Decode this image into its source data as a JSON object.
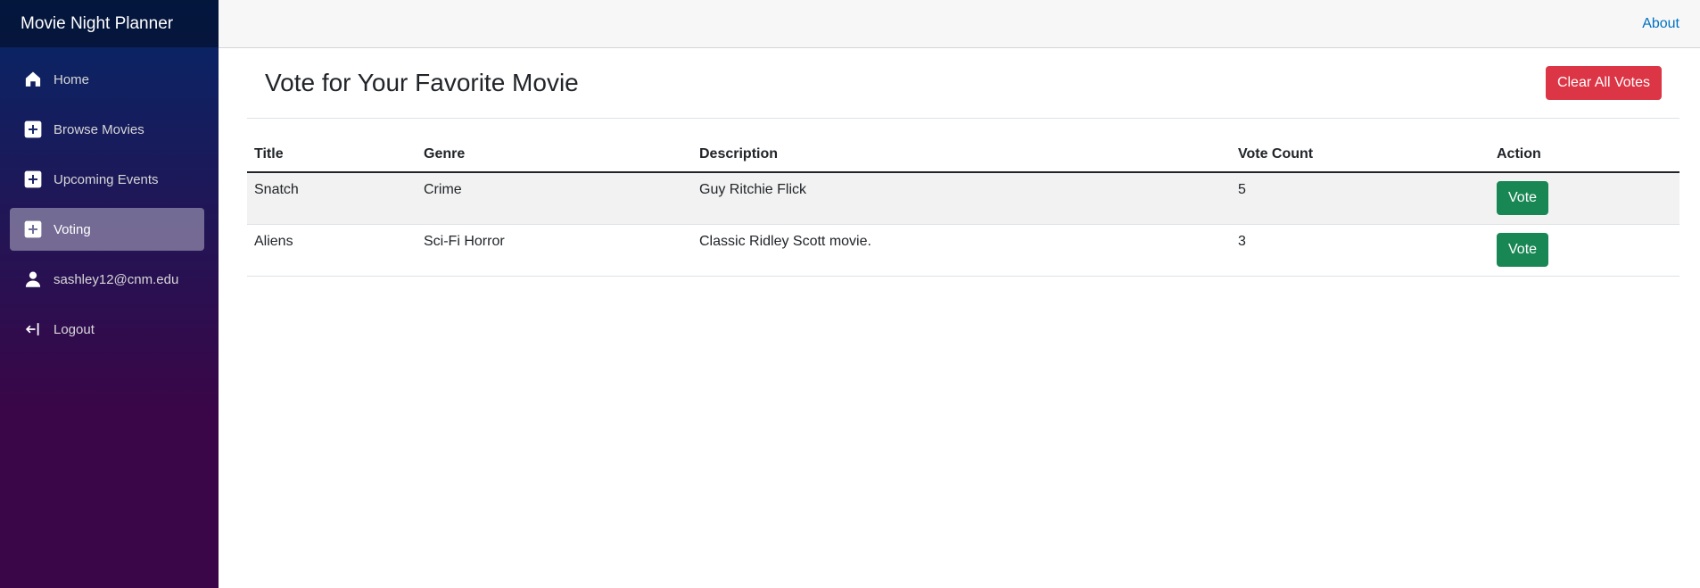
{
  "app": {
    "title": "Movie Night Planner"
  },
  "sidebar": {
    "items": [
      {
        "label": "Home",
        "icon": "home-icon"
      },
      {
        "label": "Browse Movies",
        "icon": "plus-square-icon"
      },
      {
        "label": "Upcoming Events",
        "icon": "plus-square-icon"
      },
      {
        "label": "Voting",
        "icon": "plus-square-icon",
        "active": true
      },
      {
        "label": "sashley12@cnm.edu",
        "icon": "person-icon"
      },
      {
        "label": "Logout",
        "icon": "logout-icon"
      }
    ]
  },
  "topbar": {
    "about_label": "About"
  },
  "page": {
    "title": "Vote for Your Favorite Movie",
    "clear_button_label": "Clear All Votes"
  },
  "table": {
    "headers": [
      "Title",
      "Genre",
      "Description",
      "Vote Count",
      "Action"
    ],
    "rows": [
      {
        "title": "Snatch",
        "genre": "Crime",
        "description": "Guy Ritchie Flick",
        "votes": "5",
        "action": "Vote"
      },
      {
        "title": "Aliens",
        "genre": "Sci-Fi Horror",
        "description": "Classic Ridley Scott movie.",
        "votes": "3",
        "action": "Vote"
      }
    ]
  },
  "colors": {
    "sidebar_top": "#052767",
    "sidebar_bottom": "#3a0647",
    "danger": "#dc3545",
    "success": "#198754",
    "link": "#0071c1"
  }
}
